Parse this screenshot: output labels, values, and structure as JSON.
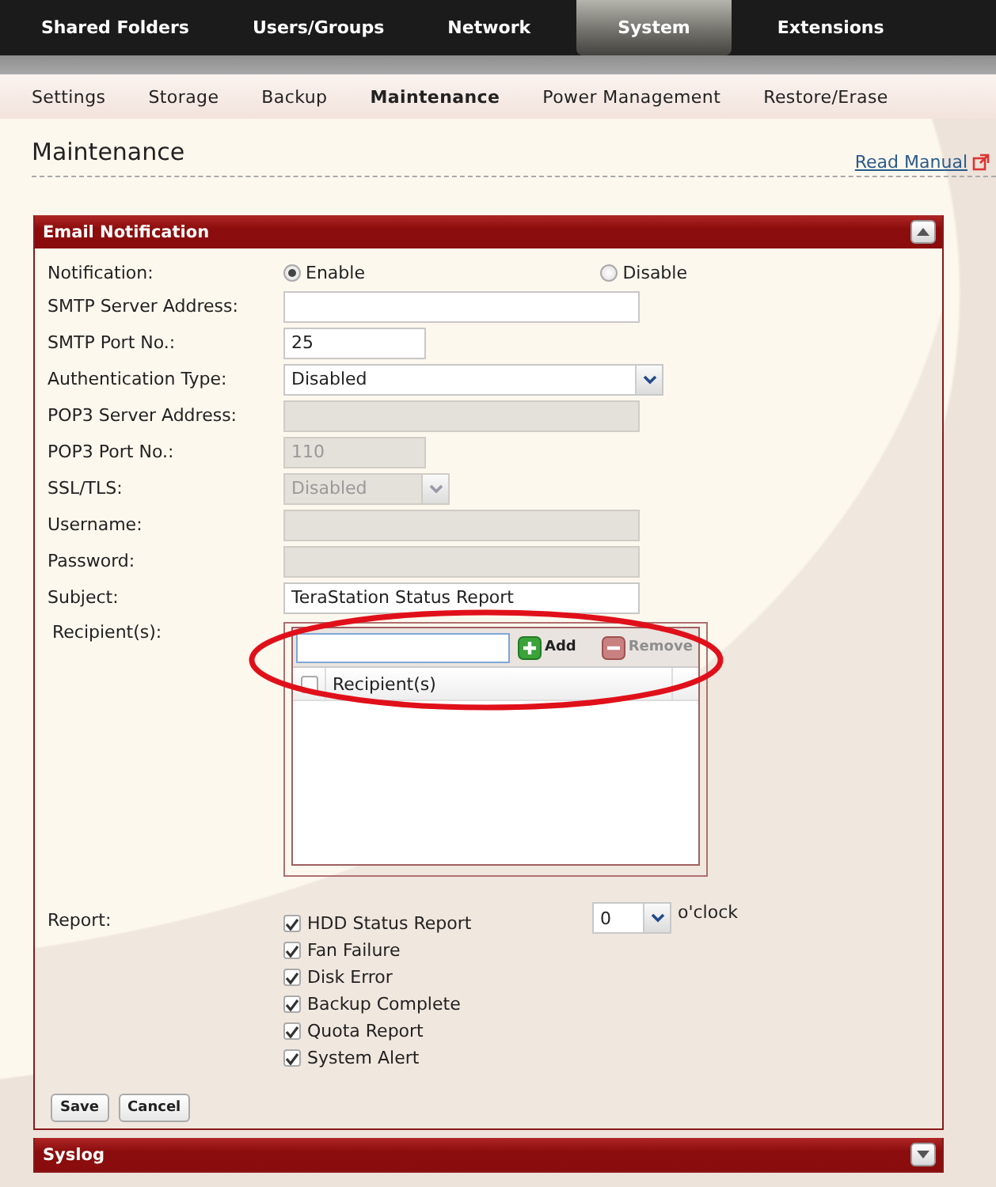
{
  "top_nav": [
    {
      "label": "Shared Folders",
      "selected": false
    },
    {
      "label": "Users/Groups",
      "selected": false
    },
    {
      "label": "Network",
      "selected": false
    },
    {
      "label": "System",
      "selected": true
    },
    {
      "label": "Extensions",
      "selected": false
    }
  ],
  "sub_nav": [
    {
      "label": "Settings",
      "selected": false
    },
    {
      "label": "Storage",
      "selected": false
    },
    {
      "label": "Backup",
      "selected": false
    },
    {
      "label": "Maintenance",
      "selected": true
    },
    {
      "label": "Power Management",
      "selected": false
    },
    {
      "label": "Restore/Erase",
      "selected": false
    }
  ],
  "page": {
    "title": "Maintenance",
    "help_link": "Read Manual"
  },
  "panels": [
    {
      "title": "Email Notification",
      "expanded": true,
      "fields": [
        {
          "label": "Notification:",
          "kind": "radio",
          "options": [
            {
              "label": "Enable",
              "selected": true
            },
            {
              "label": "Disable",
              "selected": false
            }
          ]
        },
        {
          "label": "SMTP Server Address:",
          "kind": "text",
          "disabled": false
        },
        {
          "label": "SMTP Port No.:",
          "kind": "number",
          "value": "25",
          "disabled": false
        },
        {
          "label": "Authentication Type:",
          "kind": "select",
          "value": "Disabled",
          "disabled": false
        },
        {
          "label": "POP3 Server Address:",
          "kind": "text",
          "disabled": true
        },
        {
          "label": "POP3 Port No.:",
          "kind": "number",
          "value": "110",
          "disabled": true
        },
        {
          "label": "SSL/TLS:",
          "kind": "select",
          "value": "Disabled",
          "disabled": true
        },
        {
          "label": "Username:",
          "kind": "text",
          "disabled": true
        },
        {
          "label": "Password:",
          "kind": "text",
          "disabled": true
        },
        {
          "label": "Subject:",
          "kind": "text",
          "value": "TeraStation Status Report",
          "disabled": false
        }
      ],
      "recipients": {
        "label": "Recipient(s):",
        "add_button": "Add",
        "remove_button": "Remove",
        "remove_disabled": true,
        "column": "Recipient(s)",
        "select_all_checked": false
      },
      "report": {
        "label": "Report:",
        "items": [
          {
            "label": "HDD Status Report",
            "checked": true
          },
          {
            "label": "Fan Failure",
            "checked": true
          },
          {
            "label": "Disk Error",
            "checked": true
          },
          {
            "label": "Backup Complete",
            "checked": true
          },
          {
            "label": "Quota Report",
            "checked": true
          },
          {
            "label": "System Alert",
            "checked": true
          }
        ],
        "hour": {
          "value": "0",
          "suffix": "o'clock"
        }
      },
      "buttons": [
        "Save",
        "Cancel"
      ]
    },
    {
      "title": "Syslog",
      "expanded": false
    }
  ],
  "annotations": [
    {
      "kind": "ellipse"
    }
  ]
}
